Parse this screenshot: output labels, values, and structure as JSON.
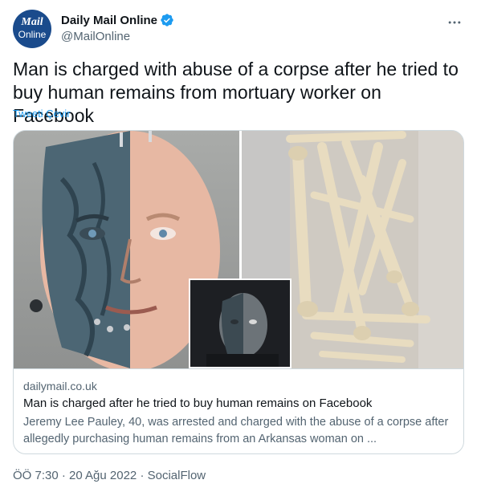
{
  "author": {
    "avatar_line1": "Mail",
    "avatar_line2": "Online",
    "display_name": "Daily Mail Online",
    "handle": "@MailOnline"
  },
  "tweet": {
    "text": "Man is charged with abuse of a corpse after he tried to buy human remains from mortuary worker on Facebook",
    "translate_label": "Tweeti Çevir"
  },
  "card": {
    "domain": "dailymail.co.uk",
    "title": "Man is charged after he tried to buy human remains on Facebook",
    "description": "Jeremy Lee Pauley, 40, was arrested and charged with the abuse of a corpse after allegedly purchasing human remains from an Arkansas woman on ..."
  },
  "footer": {
    "timestamp": "ÖÖ 7:30 · 20 Ağu 2022 · SocialFlow"
  },
  "colors": {
    "accent": "#1d9bf0",
    "avatar_bg": "#1a4b8c",
    "secondary_text": "#536471"
  },
  "icons": {
    "verified": "verified-badge-icon",
    "more": "more-horizontal-icon"
  }
}
